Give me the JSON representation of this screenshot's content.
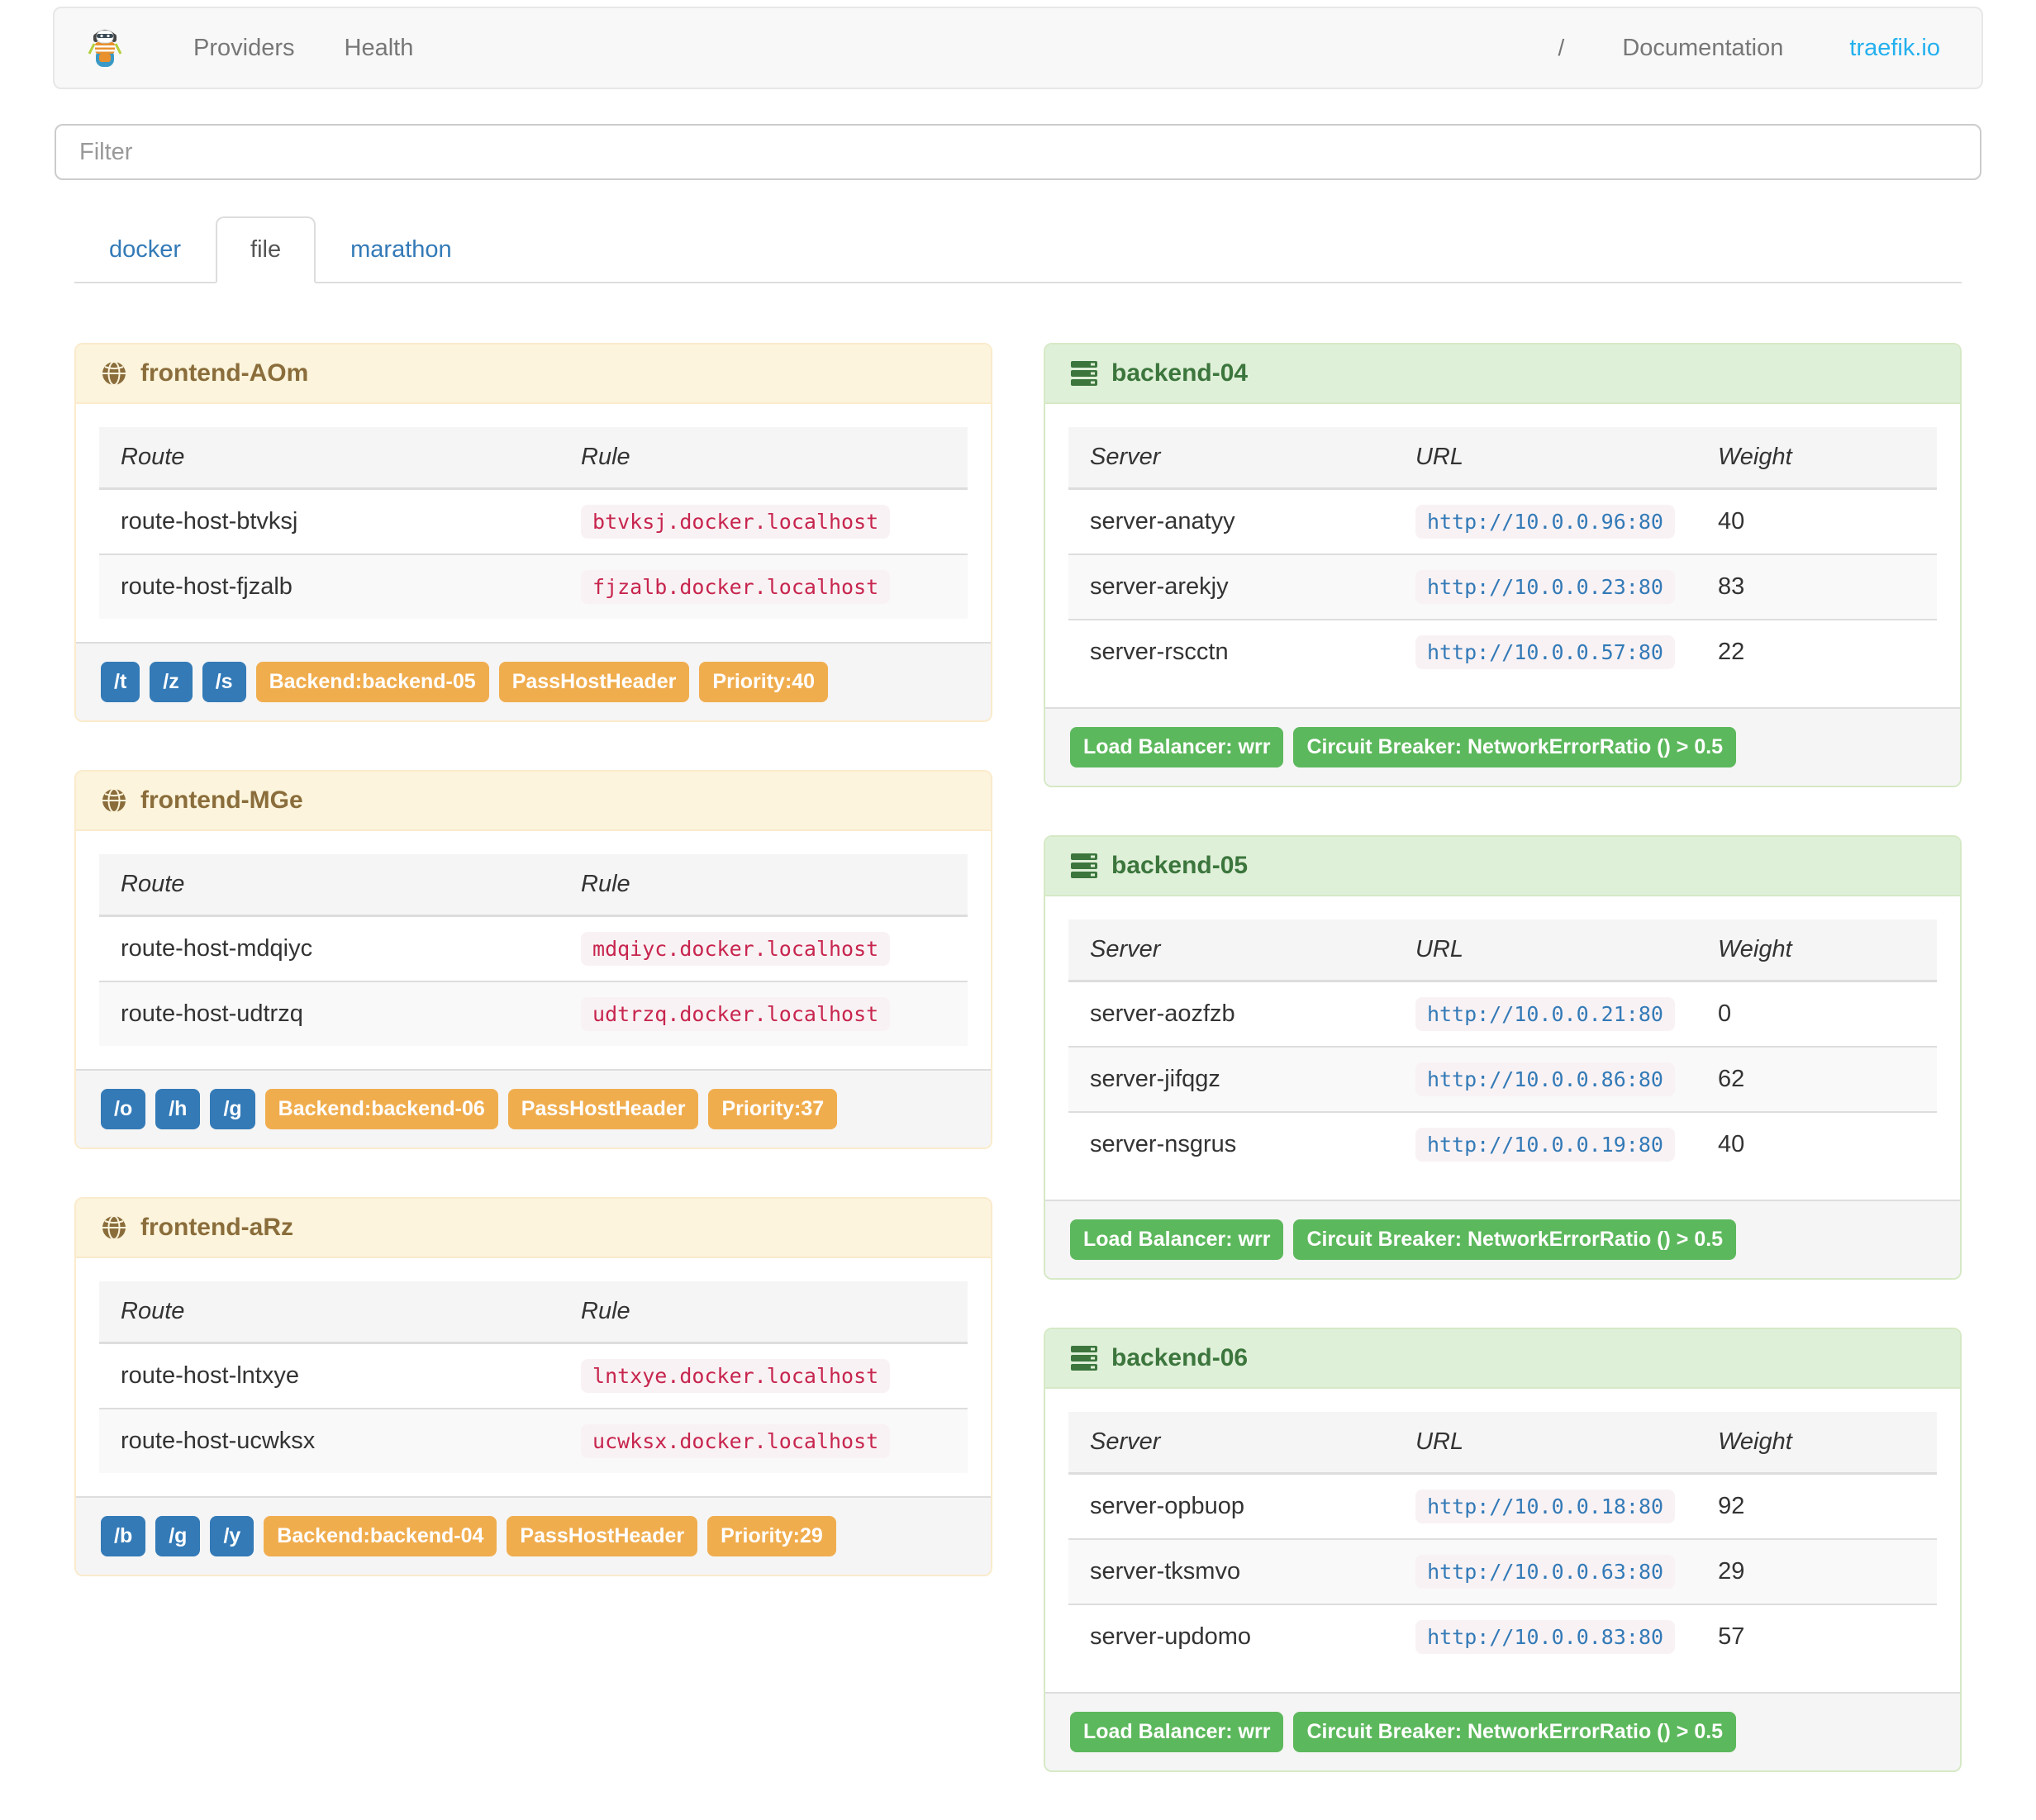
{
  "navbar": {
    "logo": "traefik-mascot",
    "links": [
      {
        "label": "Providers"
      },
      {
        "label": "Health"
      }
    ],
    "right": {
      "separator": "/",
      "documentation_label": "Documentation",
      "site_label": "traefik.io"
    }
  },
  "filter": {
    "placeholder": "Filter"
  },
  "tabs": [
    {
      "label": "docker",
      "active": false
    },
    {
      "label": "file",
      "active": true
    },
    {
      "label": "marathon",
      "active": false
    }
  ],
  "frontend_columns": [
    "Route",
    "Rule"
  ],
  "backend_columns": [
    "Server",
    "URL",
    "Weight"
  ],
  "frontends": [
    {
      "name": "frontend-AOm",
      "routes": [
        {
          "route": "route-host-btvksj",
          "rule": "btvksj.docker.localhost"
        },
        {
          "route": "route-host-fjzalb",
          "rule": "fjzalb.docker.localhost"
        }
      ],
      "entry_points": [
        "/t",
        "/z",
        "/s"
      ],
      "tags": [
        "Backend:backend-05",
        "PassHostHeader",
        "Priority:40"
      ]
    },
    {
      "name": "frontend-MGe",
      "routes": [
        {
          "route": "route-host-mdqiyc",
          "rule": "mdqiyc.docker.localhost"
        },
        {
          "route": "route-host-udtrzq",
          "rule": "udtrzq.docker.localhost"
        }
      ],
      "entry_points": [
        "/o",
        "/h",
        "/g"
      ],
      "tags": [
        "Backend:backend-06",
        "PassHostHeader",
        "Priority:37"
      ]
    },
    {
      "name": "frontend-aRz",
      "routes": [
        {
          "route": "route-host-lntxye",
          "rule": "lntxye.docker.localhost"
        },
        {
          "route": "route-host-ucwksx",
          "rule": "ucwksx.docker.localhost"
        }
      ],
      "entry_points": [
        "/b",
        "/g",
        "/y"
      ],
      "tags": [
        "Backend:backend-04",
        "PassHostHeader",
        "Priority:29"
      ]
    }
  ],
  "backends": [
    {
      "name": "backend-04",
      "servers": [
        {
          "server": "server-anatyy",
          "url": "http://10.0.0.96:80",
          "weight": "40"
        },
        {
          "server": "server-arekjy",
          "url": "http://10.0.0.23:80",
          "weight": "83"
        },
        {
          "server": "server-rscctn",
          "url": "http://10.0.0.57:80",
          "weight": "22"
        }
      ],
      "tags": [
        "Load Balancer: wrr",
        "Circuit Breaker: NetworkErrorRatio () > 0.5"
      ]
    },
    {
      "name": "backend-05",
      "servers": [
        {
          "server": "server-aozfzb",
          "url": "http://10.0.0.21:80",
          "weight": "0"
        },
        {
          "server": "server-jifqgz",
          "url": "http://10.0.0.86:80",
          "weight": "62"
        },
        {
          "server": "server-nsgrus",
          "url": "http://10.0.0.19:80",
          "weight": "40"
        }
      ],
      "tags": [
        "Load Balancer: wrr",
        "Circuit Breaker: NetworkErrorRatio () > 0.5"
      ]
    },
    {
      "name": "backend-06",
      "servers": [
        {
          "server": "server-opbuop",
          "url": "http://10.0.0.18:80",
          "weight": "92"
        },
        {
          "server": "server-tksmvo",
          "url": "http://10.0.0.63:80",
          "weight": "29"
        },
        {
          "server": "server-updomo",
          "url": "http://10.0.0.83:80",
          "weight": "57"
        }
      ],
      "tags": [
        "Load Balancer: wrr",
        "Circuit Breaker: NetworkErrorRatio () > 0.5"
      ]
    }
  ],
  "colors": {
    "navbar_bg": "#f8f8f8",
    "link_blue": "#337ab7",
    "brand_blue": "#24b0ee",
    "frontend_heading_bg": "#fcf4dc",
    "frontend_heading_text": "#8a6d3b",
    "backend_heading_bg": "#dff0d8",
    "backend_heading_text": "#3c763d",
    "label_blue": "#337ab7",
    "label_orange": "#f0ad4e",
    "label_green": "#5cb85c",
    "code_pink_bg": "#f9f2f4",
    "code_red_text": "#c7254e"
  }
}
